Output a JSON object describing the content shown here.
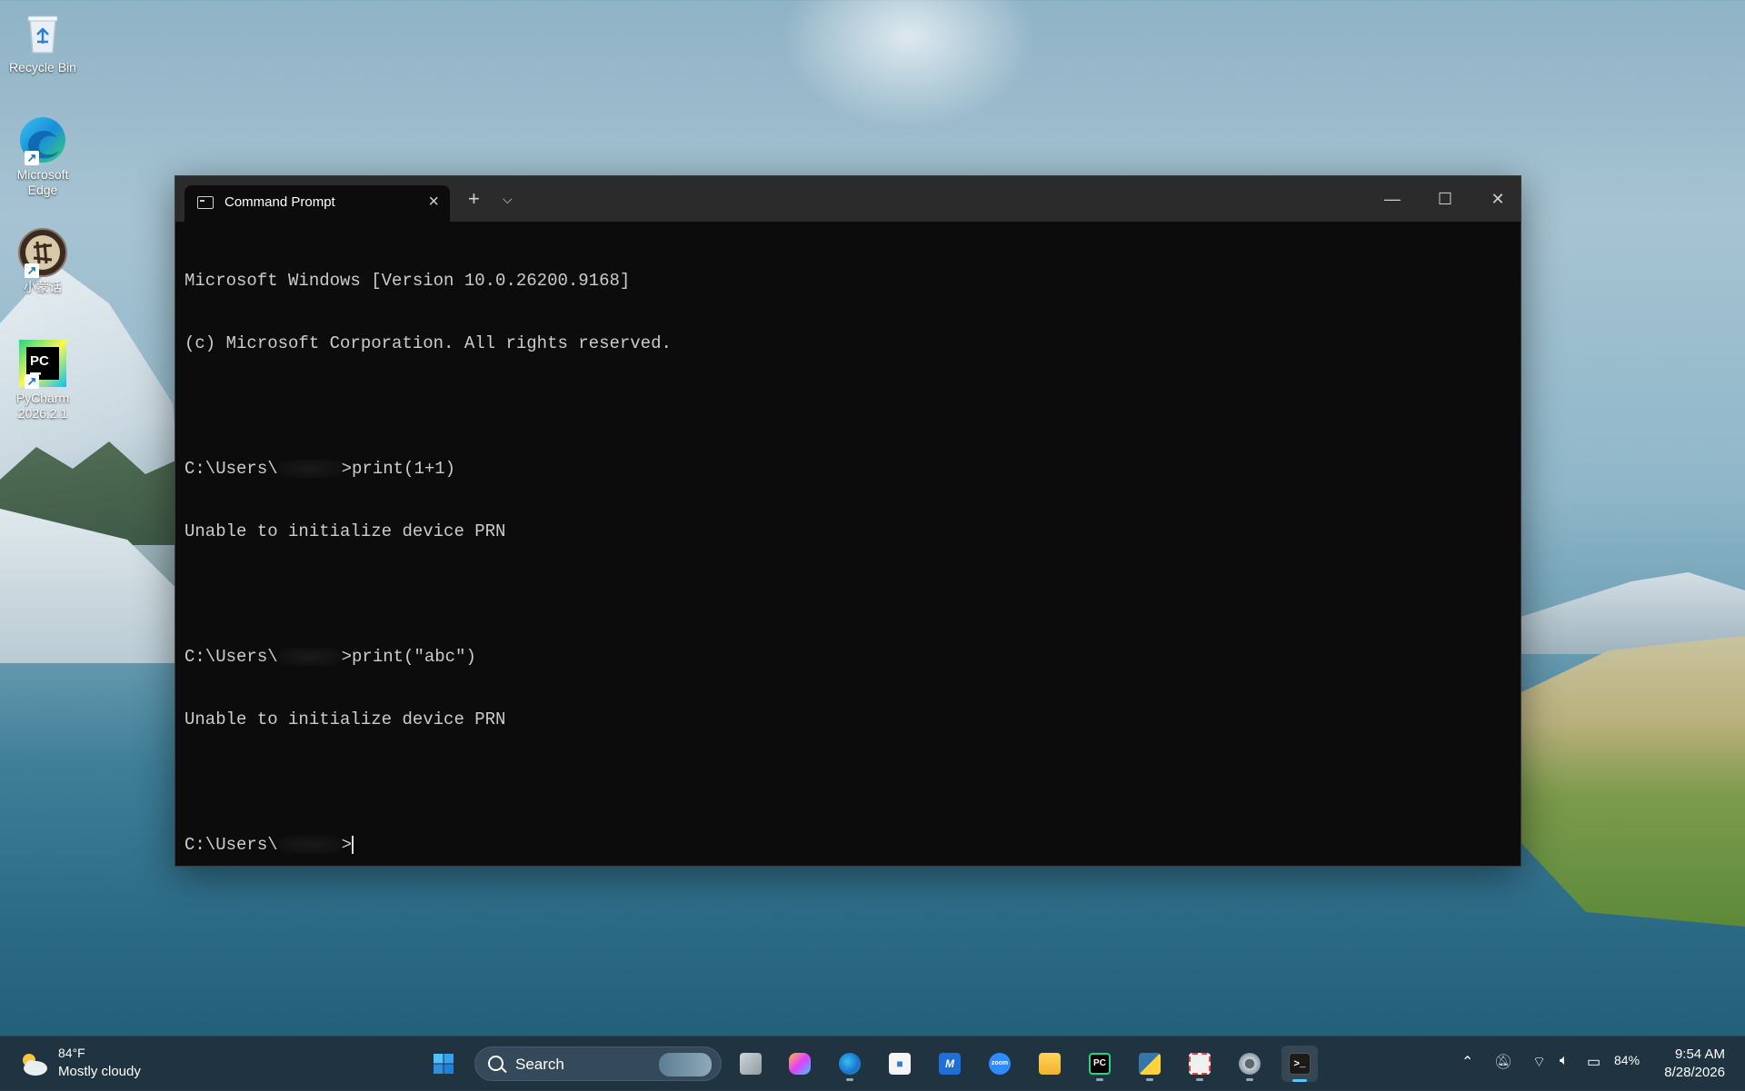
{
  "desktop": {
    "icons": [
      {
        "label": "Recycle Bin"
      },
      {
        "label": "Microsoft Edge"
      },
      {
        "label": "小蒙话"
      },
      {
        "label": "PyCharm 2026.2.1"
      }
    ]
  },
  "window": {
    "tab_title": "Command Prompt",
    "buttons": {
      "minimize": "—",
      "maximize": "☐",
      "close": "✕"
    },
    "console_lines": [
      "Microsoft Windows [Version 10.0.26200.9168]",
      "(c) Microsoft Corporation. All rights reserved.",
      "",
      {
        "prefix": "C:\\Users\\",
        "suffix": ">print(1+1)"
      },
      "Unable to initialize device PRN",
      "",
      {
        "prefix": "C:\\Users\\",
        "suffix": ">print(\"abc\")"
      },
      "Unable to initialize device PRN",
      "",
      {
        "prefix": "C:\\Users\\",
        "suffix": ">"
      }
    ]
  },
  "taskbar": {
    "weather": {
      "temp": "84°F",
      "desc": "Mostly cloudy"
    },
    "search_label": "Search",
    "apps": [
      "start",
      "task-view",
      "copilot",
      "edge",
      "store",
      "app-m",
      "zoom",
      "file-explorer",
      "pycharm",
      "python-shell",
      "snipping",
      "settings",
      "terminal"
    ],
    "battery": "84%",
    "time": "9:54 AM",
    "date": "8/28/2026"
  },
  "colors": {
    "console_bg": "#0c0c0c",
    "console_text": "#cccccc",
    "titlebar_bg": "#2b2b2b",
    "active_indicator": "#5cc4ff"
  }
}
